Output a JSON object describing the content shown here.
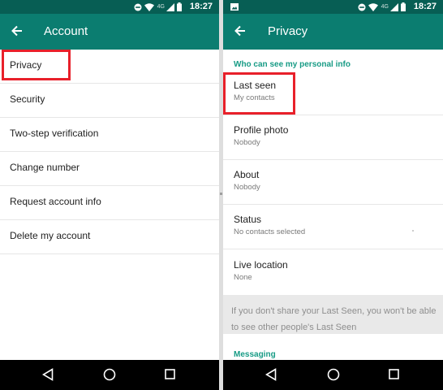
{
  "statusbar": {
    "time": "18:27",
    "network_label": "4G"
  },
  "account": {
    "title": "Account",
    "items": [
      {
        "label": "Privacy"
      },
      {
        "label": "Security"
      },
      {
        "label": "Two-step verification"
      },
      {
        "label": "Change number"
      },
      {
        "label": "Request account info"
      },
      {
        "label": "Delete my account"
      }
    ]
  },
  "privacy": {
    "title": "Privacy",
    "section_personal": "Who can see my personal info",
    "items": [
      {
        "title": "Last seen",
        "value": "My contacts"
      },
      {
        "title": "Profile photo",
        "value": "Nobody"
      },
      {
        "title": "About",
        "value": "Nobody"
      },
      {
        "title": "Status",
        "value": "No contacts selected"
      },
      {
        "title": "Live location",
        "value": "None"
      }
    ],
    "note": "If you don't share your Last Seen, you won't be able to see other people's Last Seen",
    "section_messaging": "Messaging"
  },
  "colors": {
    "statusbar": "#075e54",
    "appbar": "#0b7d70",
    "accent": "#179b85",
    "highlight": "#e8202a"
  },
  "icons": [
    "back-arrow-icon",
    "dnd-icon",
    "wifi-icon",
    "signal-icon",
    "battery-icon",
    "image-notification-icon",
    "nav-back-icon",
    "nav-home-icon",
    "nav-recents-icon"
  ]
}
